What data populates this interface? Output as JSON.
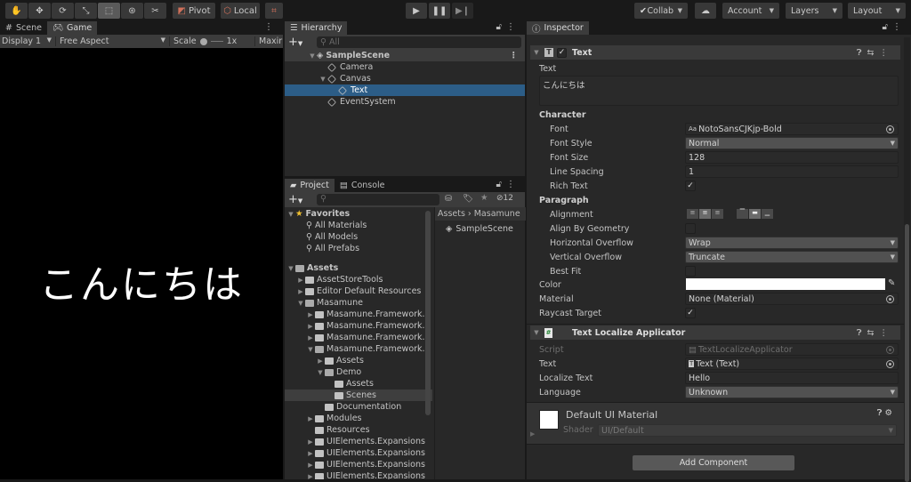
{
  "toolbar": {
    "tools": [
      "hand-tool",
      "move-tool",
      "rotate-tool",
      "scale-tool",
      "rect-tool",
      "transform-tool",
      "custom-tool"
    ],
    "active_tool": "rect-tool",
    "pivot_label": "Pivot",
    "local_label": "Local",
    "play_controls": [
      "play",
      "pause",
      "step"
    ],
    "collab_label": "Collab",
    "account_label": "Account",
    "layers_label": "Layers",
    "layout_label": "Layout"
  },
  "game_panel": {
    "tabs": [
      {
        "label": "Scene",
        "active": false
      },
      {
        "label": "Game",
        "active": true
      }
    ],
    "display": "Display 1",
    "aspect": "Free Aspect",
    "scale_label": "Scale",
    "scale_value": "1x",
    "maximize_label": "Maxir",
    "game_text": "こんにちは"
  },
  "hierarchy": {
    "tab_label": "Hierarchy",
    "search_placeholder": "All",
    "items": [
      {
        "label": "SampleScene",
        "depth": 0,
        "expanded": true,
        "type": "scene",
        "selected": false
      },
      {
        "label": "Camera",
        "depth": 1,
        "type": "object",
        "selected": false
      },
      {
        "label": "Canvas",
        "depth": 1,
        "expanded": true,
        "type": "object",
        "selected": false
      },
      {
        "label": "Text",
        "depth": 2,
        "type": "object",
        "selected": true
      },
      {
        "label": "EventSystem",
        "depth": 1,
        "type": "object",
        "selected": false
      }
    ]
  },
  "project": {
    "tabs": [
      {
        "label": "Project",
        "active": true
      },
      {
        "label": "Console",
        "active": false
      }
    ],
    "hidden_count": "12",
    "breadcrumb": [
      "Assets",
      "Masamune"
    ],
    "favorites_label": "Favorites",
    "favorites": [
      "All Materials",
      "All Models",
      "All Prefabs"
    ],
    "tree": [
      {
        "label": "Assets",
        "depth": 0,
        "open": true,
        "bold": true
      },
      {
        "label": "AssetStoreTools",
        "depth": 1,
        "arrow": true
      },
      {
        "label": "Editor Default Resources",
        "depth": 1,
        "arrow": true
      },
      {
        "label": "Masamune",
        "depth": 1,
        "open": true
      },
      {
        "label": "Masamune.Framework.",
        "depth": 2,
        "arrow": true
      },
      {
        "label": "Masamune.Framework.",
        "depth": 2,
        "arrow": true
      },
      {
        "label": "Masamune.Framework.",
        "depth": 2,
        "arrow": true
      },
      {
        "label": "Masamune.Framework.",
        "depth": 2,
        "open": true
      },
      {
        "label": "Assets",
        "depth": 3,
        "arrow": true
      },
      {
        "label": "Demo",
        "depth": 3,
        "open": true
      },
      {
        "label": "Assets",
        "depth": 4
      },
      {
        "label": "Scenes",
        "depth": 4,
        "selected": true
      },
      {
        "label": "Documentation",
        "depth": 3
      },
      {
        "label": "Modules",
        "depth": 2,
        "arrow": true
      },
      {
        "label": "Resources",
        "depth": 2
      },
      {
        "label": "UIElements.Expansions",
        "depth": 2,
        "arrow": true
      },
      {
        "label": "UIElements.Expansions",
        "depth": 2,
        "arrow": true
      },
      {
        "label": "UIElements.Expansions",
        "depth": 2,
        "arrow": true
      },
      {
        "label": "UIElements.Expansions",
        "depth": 2,
        "arrow": true
      }
    ],
    "files": [
      "SampleScene"
    ]
  },
  "inspector": {
    "tab_label": "Inspector",
    "text_component": {
      "title": "Text",
      "enabled": true,
      "text_label": "Text",
      "text_value": "こんにちは",
      "character_label": "Character",
      "font_label": "Font",
      "font_value": "NotoSansCJKjp-Bold",
      "font_style_label": "Font Style",
      "font_style_value": "Normal",
      "font_size_label": "Font Size",
      "font_size_value": "128",
      "line_spacing_label": "Line Spacing",
      "line_spacing_value": "1",
      "rich_text_label": "Rich Text",
      "rich_text_checked": true,
      "paragraph_label": "Paragraph",
      "alignment_label": "Alignment",
      "align_geometry_label": "Align By Geometry",
      "align_geometry_checked": false,
      "h_overflow_label": "Horizontal Overflow",
      "h_overflow_value": "Wrap",
      "v_overflow_label": "Vertical Overflow",
      "v_overflow_value": "Truncate",
      "best_fit_label": "Best Fit",
      "best_fit_checked": false,
      "color_label": "Color",
      "color_value": "#ffffff",
      "material_label": "Material",
      "material_value": "None (Material)",
      "raycast_label": "Raycast Target",
      "raycast_checked": true
    },
    "localize_component": {
      "title": "Text Localize Applicator",
      "script_label": "Script",
      "script_value": "TextLocalizeApplicator",
      "text_label": "Text",
      "text_value": "Text (Text)",
      "localize_label": "Localize Text",
      "localize_value": "Hello",
      "language_label": "Language",
      "language_value": "Unknown"
    },
    "material": {
      "title": "Default UI Material",
      "shader_label": "Shader",
      "shader_value": "UI/Default"
    },
    "add_component_label": "Add Component"
  }
}
